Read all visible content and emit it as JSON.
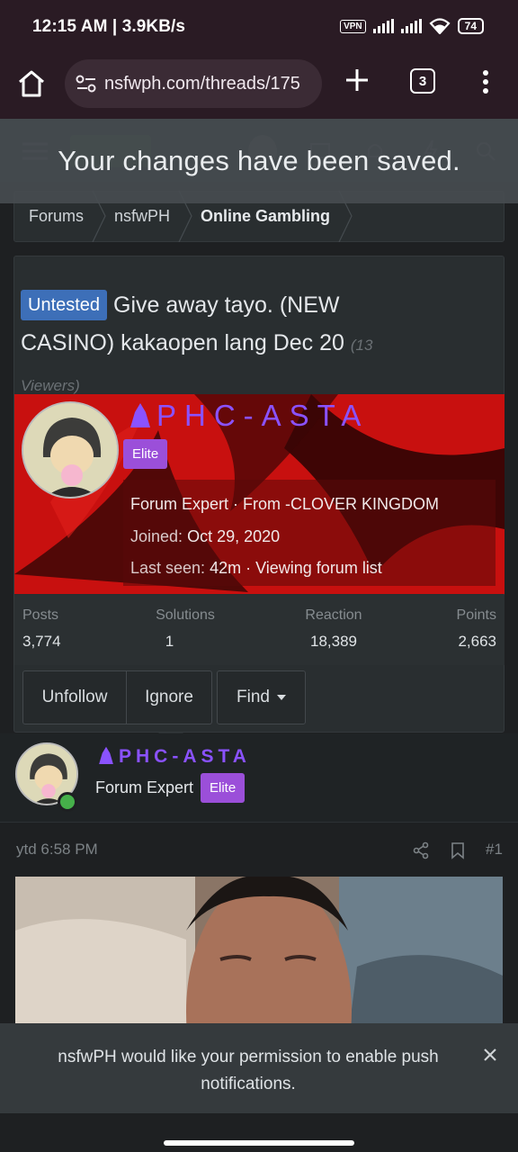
{
  "status_bar": {
    "time": "12:15 AM | 3.9KB/s",
    "vpn": "VPN",
    "battery": "74"
  },
  "browser": {
    "url": "nsfwph.com/threads/175",
    "tab_count": "3"
  },
  "toast": {
    "message": "Your changes have been saved."
  },
  "breadcrumb": {
    "items": [
      "Forums",
      "nsfwPH",
      "Online Gambling"
    ]
  },
  "thread": {
    "prefix": "Untested",
    "title": "Give away tayo. (NEW CASINO) kakaopen lang Dec 20",
    "viewers": "(13 Viewers)"
  },
  "member_card": {
    "username": "PHC-ASTA",
    "badge": "Elite",
    "title_line": "Forum Expert · From -CLOVER KINGDOM",
    "joined_label": "Joined:",
    "joined_value": "Oct 29, 2020",
    "last_seen_label": "Last seen:",
    "last_seen_value": "42m · Viewing forum list",
    "stats": [
      {
        "label": "Posts",
        "value": "3,774"
      },
      {
        "label": "Solutions",
        "value": "1"
      },
      {
        "label": "Reaction",
        "value": "18,389"
      },
      {
        "label": "Points",
        "value": "2,663"
      }
    ],
    "buttons": {
      "unfollow": "Unfollow",
      "ignore": "Ignore",
      "find": "Find"
    }
  },
  "post": {
    "username": "PHC-ASTA",
    "role": "Forum Expert",
    "badge": "Elite",
    "time": "ytd 6:58 PM",
    "number": "#1"
  },
  "push_prompt": {
    "message": "nsfwPH would like your permission to enable push notifications."
  },
  "colors": {
    "username": "#8a52ff",
    "elite_badge": "#9b4fd9",
    "prefix_tag": "#3d6fb8",
    "banner_red": "#c8100f",
    "online": "#46b04a"
  }
}
